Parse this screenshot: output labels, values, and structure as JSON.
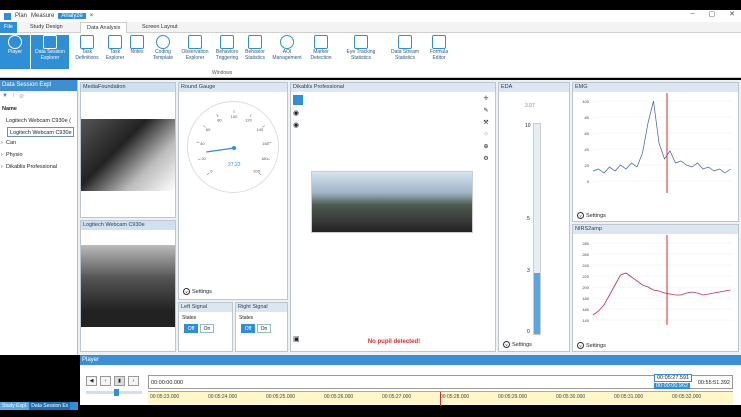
{
  "titlebar": {
    "app_icon": "app-logo-icon",
    "plan": "Plan",
    "measure": "Measure",
    "analyze": "Analyze"
  },
  "tabs": {
    "file": "File",
    "study_design": "Study Design",
    "data_analysis": "Data Analysis",
    "screen_layout": "Screen Layout"
  },
  "ribbon": {
    "buttons": [
      {
        "label": "Player"
      },
      {
        "label": "Data Session Explorer"
      },
      {
        "label": "Task Definitions"
      },
      {
        "label": "Task Explorer"
      },
      {
        "label": "Notes"
      },
      {
        "label": "Coding Template"
      },
      {
        "label": "Observation Explorer"
      },
      {
        "label": "Behaviors Triggering"
      },
      {
        "label": "Behavior Statistics"
      },
      {
        "label": "AOI Management"
      },
      {
        "label": "Marker Detection"
      },
      {
        "label": "Eye Tracking Statistics"
      },
      {
        "label": "Data Stream Statistics"
      },
      {
        "label": "Formula Editor"
      }
    ],
    "group_label": "Windows"
  },
  "left_panel": {
    "title": "Data Session Expl",
    "section": "Name",
    "items": [
      "Logitech Webcam C930e (",
      "Logitech Webcam C930e",
      "Can",
      "Physio",
      "Dikablis Professional"
    ]
  },
  "panels": {
    "media_foundation": "MediaFoundation",
    "logitech": "Logitech Webcam C930e",
    "round_gauge": "Round Gauge",
    "dikablis": "Dikablis Professional",
    "eda": "EDA",
    "emg": "EMG",
    "nirs": "NIRS2amp"
  },
  "gauge": {
    "value_text": "27.22",
    "ticks": [
      "0",
      "20",
      "40",
      "60",
      "80",
      "100",
      "120",
      "140",
      "160",
      "180",
      "200"
    ],
    "value": 27.22,
    "max": 200
  },
  "left_signal": {
    "title": "Left Signal",
    "states": "States",
    "off": "Off",
    "on": "On"
  },
  "right_signal": {
    "title": "Right Signal",
    "states": "States",
    "off": "Off",
    "on": "On"
  },
  "settings_label": "Settings",
  "eda": {
    "value_text": "3.07",
    "ticks": [
      "10",
      "5",
      "3",
      "0"
    ],
    "level": 0.29
  },
  "dikablis_status": "No pupil detected!",
  "emg_chart": {
    "yticks": [
      "100",
      "80",
      "60",
      "40",
      "20",
      "0"
    ]
  },
  "nirs_chart": {
    "yticks": [
      "280",
      "260",
      "240",
      "220",
      "200",
      "180",
      "160",
      "140"
    ]
  },
  "player": {
    "title": "Player",
    "start_time": "00:00:00.000",
    "current_time": "00:05:27.591",
    "end_time": "00:55:51.392",
    "offset": "00:00:00.962",
    "timeline_ticks": [
      "00:05:23.000",
      "00:05:24.000",
      "00:05:25.000",
      "00:05:26.000",
      "00:05:27.000",
      "00:05:28.000",
      "00:05:29.000",
      "00:05:30.000",
      "00:05:31.000",
      "00:05:32.000"
    ]
  },
  "bottom_tabs": [
    "Study Expl.",
    "Data Session Ex"
  ],
  "colors": {
    "accent": "#2e8fd6",
    "cursor": "#e3262b",
    "emg_line": "#3a5bb0",
    "nirs_line": "#c0304a"
  }
}
